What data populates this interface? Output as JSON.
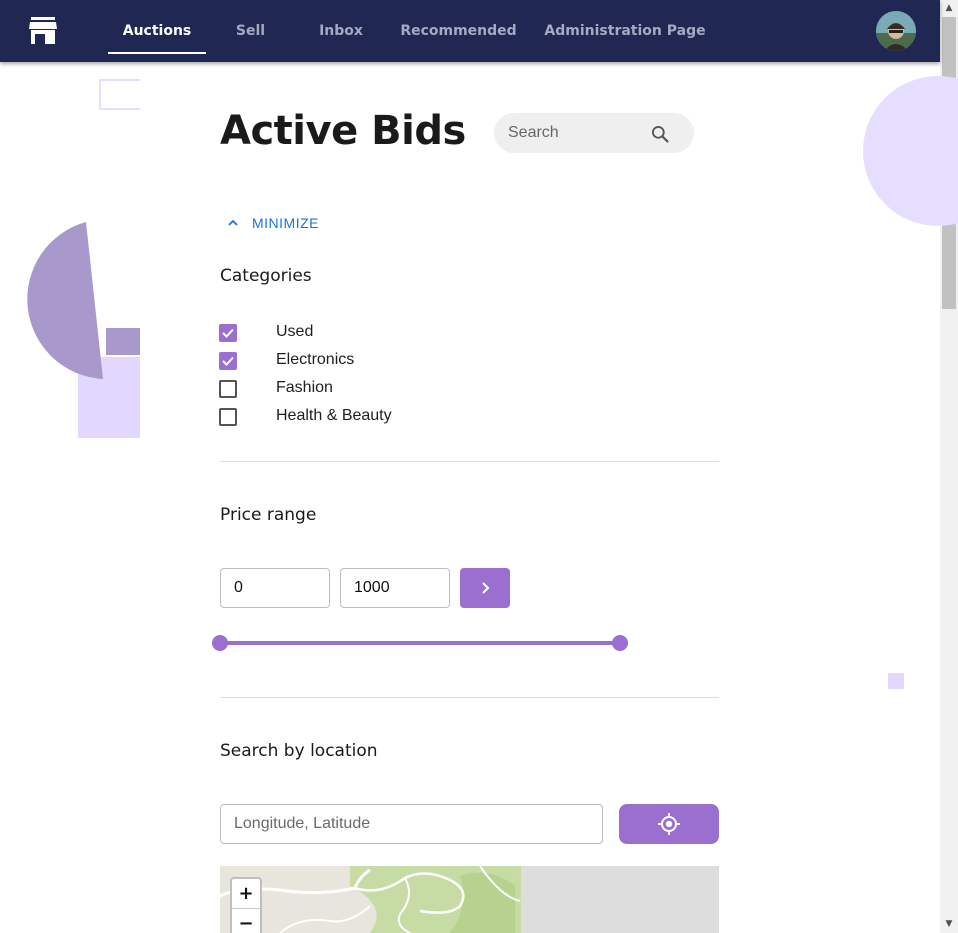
{
  "nav": {
    "logo_icon": "storefront-icon",
    "tabs": [
      {
        "label": "Auctions",
        "active": true
      },
      {
        "label": "Sell",
        "active": false
      },
      {
        "label": "Inbox",
        "active": false
      },
      {
        "label": "Recommended",
        "active": false
      },
      {
        "label": "Administration Page",
        "active": false
      }
    ],
    "avatar_icon": "user-avatar"
  },
  "main": {
    "title": "Active Bids",
    "search": {
      "placeholder": "Search",
      "icon": "search-icon"
    },
    "minimize_label": "MINIMIZE",
    "categories": {
      "title": "Categories",
      "items": [
        {
          "label": "Used",
          "checked": true
        },
        {
          "label": "Electronics",
          "checked": true
        },
        {
          "label": "Fashion",
          "checked": false
        },
        {
          "label": "Health & Beauty",
          "checked": false
        }
      ]
    },
    "price_range": {
      "title": "Price range",
      "min": "0",
      "max": "1000",
      "apply_icon": "chevron-right-icon",
      "slider_low_fraction": 0.0,
      "slider_high_fraction": 1.0
    },
    "location": {
      "title": "Search by location",
      "placeholder": "Longitude, Latitude",
      "locate_icon": "my-location-icon",
      "map_zoom_in": "+",
      "map_zoom_out": "−"
    }
  },
  "colors": {
    "nav_bg": "#1f2752",
    "accent": "#9a6fcf",
    "link": "#1976d2"
  }
}
